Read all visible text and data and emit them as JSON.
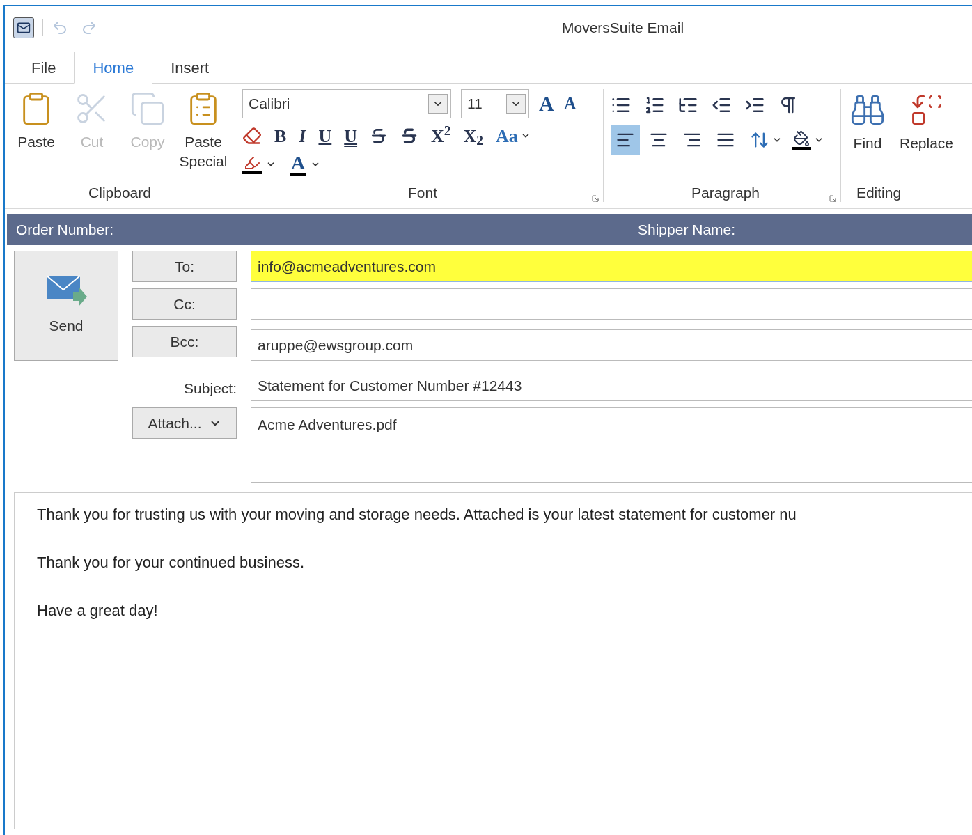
{
  "window": {
    "title": "MoversSuite Email"
  },
  "quick_access": [
    {
      "kind": "undo",
      "disabled": true
    },
    {
      "kind": "redo",
      "disabled": true
    }
  ],
  "tabs": [
    {
      "label": "File",
      "selected": false
    },
    {
      "label": "Home",
      "selected": true
    },
    {
      "label": "Insert",
      "selected": false
    }
  ],
  "ribbon": {
    "clipboard": {
      "label": "Clipboard",
      "buttons": [
        {
          "kind": "paste",
          "label": "Paste",
          "disabled": false
        },
        {
          "kind": "cut",
          "label": "Cut",
          "disabled": true
        },
        {
          "kind": "copy",
          "label": "Copy",
          "disabled": true
        },
        {
          "kind": "paste_special",
          "label": "Paste Special",
          "disabled": false
        }
      ]
    },
    "font": {
      "label": "Font",
      "font_name": "Calibri",
      "font_size": "11",
      "size_buttons": [
        {
          "kind": "grow",
          "text": "A"
        },
        {
          "kind": "shrink",
          "text": "A"
        }
      ],
      "format_buttons": [
        {
          "kind": "clear"
        },
        {
          "kind": "bold",
          "text": "B"
        },
        {
          "kind": "italic",
          "text": "I"
        },
        {
          "kind": "underline",
          "text": "U"
        },
        {
          "kind": "double_underline",
          "text": "U"
        },
        {
          "kind": "strike"
        },
        {
          "kind": "double_strike"
        },
        {
          "kind": "superscript",
          "text": "X$^{2}$"
        },
        {
          "kind": "subscript",
          "text": "X$_{2}$"
        },
        {
          "kind": "case",
          "text": "Aa"
        }
      ],
      "color_buttons": [
        {
          "kind": "highlight"
        },
        {
          "kind": "font_color",
          "text": "A"
        }
      ]
    },
    "paragraph": {
      "label": "Paragraph",
      "list_buttons": [
        {
          "kind": "bullets"
        },
        {
          "kind": "numbering"
        },
        {
          "kind": "multilevel"
        },
        {
          "kind": "outdent"
        },
        {
          "kind": "indent"
        },
        {
          "kind": "marks"
        }
      ],
      "align_buttons": [
        {
          "kind": "left",
          "selected": true
        },
        {
          "kind": "center",
          "selected": false
        },
        {
          "kind": "right",
          "selected": false
        },
        {
          "kind": "justify",
          "selected": false
        }
      ],
      "dropdown_buttons": [
        {
          "kind": "line_spacing"
        },
        {
          "kind": "shading"
        }
      ]
    },
    "editing": {
      "label": "Editing",
      "buttons": [
        {
          "kind": "find",
          "label": "Find"
        },
        {
          "kind": "replace",
          "label": "Replace"
        }
      ]
    }
  },
  "header": {
    "order_label": "Order Number:",
    "shipper_label": "Shipper Name:"
  },
  "send": {
    "label": "Send"
  },
  "fields": [
    {
      "kind": "button",
      "label": "To:",
      "value": "info@acmeadventures.com",
      "highlighted": true
    },
    {
      "kind": "button",
      "label": "Cc:",
      "highlighted": false
    },
    {
      "kind": "button",
      "label": "Bcc:",
      "value": "aruppe@ewsgroup.com",
      "highlighted": false
    },
    {
      "kind": "label",
      "label": "Subject:",
      "value": "Statement for Customer Number #12443",
      "highlighted": false
    },
    {
      "kind": "attach",
      "label": "Attach...",
      "value": "Acme Adventures.pdf",
      "highlighted": false
    }
  ],
  "body": {
    "paragraphs": [
      "Thank you for trusting us with your moving and storage needs. Attached is your latest statement for customer nu",
      "Thank you for your continued business.",
      "Have a great day!"
    ]
  }
}
